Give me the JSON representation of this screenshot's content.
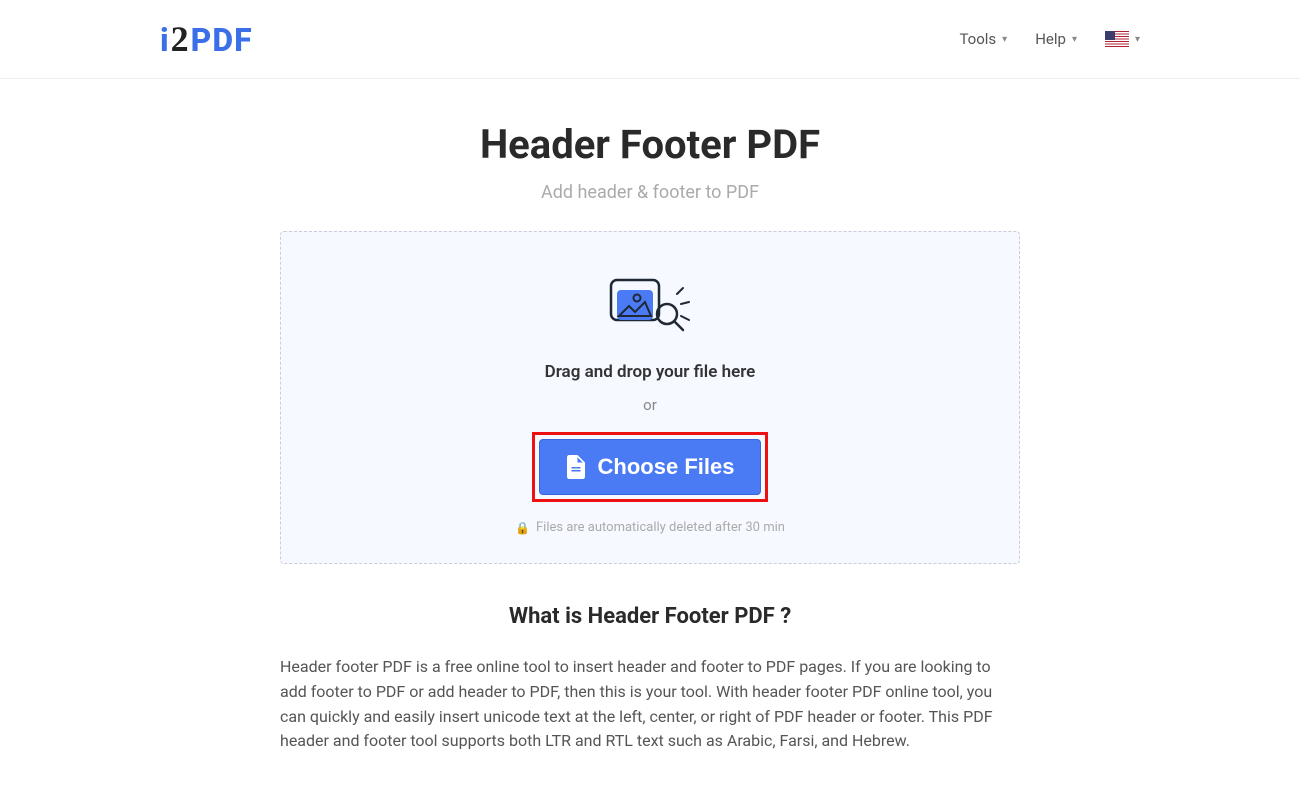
{
  "logo": {
    "part1": "i",
    "part2": "2",
    "part3": "PDF"
  },
  "nav": {
    "tools": "Tools",
    "help": "Help"
  },
  "page": {
    "title": "Header Footer PDF",
    "subtitle": "Add header & footer to PDF"
  },
  "dropzone": {
    "drag_text": "Drag and drop your file here",
    "or": "or",
    "choose": "Choose Files",
    "note": "Files are automatically deleted after 30 min"
  },
  "info": {
    "heading": "What is Header Footer PDF ?",
    "body": "Header footer PDF is a free online tool to insert header and footer to PDF pages. If you are looking to add footer to PDF or add header to PDF, then this is your tool. With header footer PDF online tool, you can quickly and easily insert unicode text at the left, center, or right of PDF header or footer. This PDF header and footer tool supports both LTR and RTL text such as Arabic, Farsi, and Hebrew."
  }
}
